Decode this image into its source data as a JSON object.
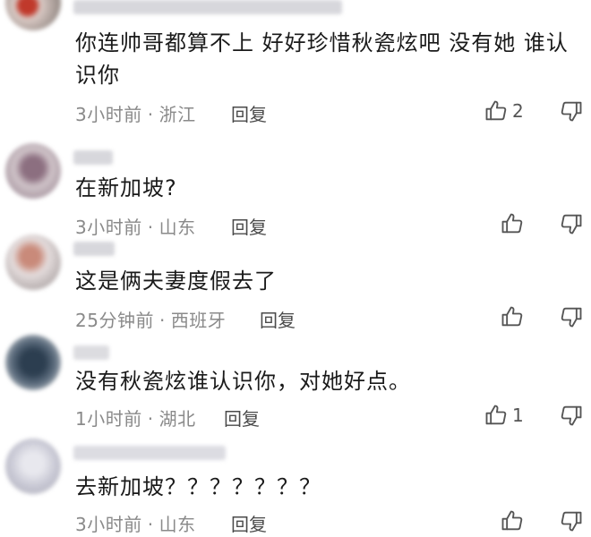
{
  "comments": [
    {
      "text": "你连帅哥都算不上  好好珍惜秋瓷炫吧 没有她 谁认识你",
      "time": "3小时前",
      "location": "浙江",
      "reply": "回复",
      "likes": "2"
    },
    {
      "text": "在新加坡?",
      "time": "3小时前",
      "location": "山东",
      "reply": "回复",
      "likes": ""
    },
    {
      "text": "这是俩夫妻度假去了",
      "time": "25分钟前",
      "location": "西班牙",
      "reply": "回复",
      "likes": ""
    },
    {
      "text": "没有秋瓷炫谁认识你，对她好点。",
      "time": "1小时前",
      "location": "湖北",
      "reply": "回复",
      "likes": "1"
    },
    {
      "text": "去新加坡？？？？？？？",
      "time": "3小时前",
      "location": "山东",
      "reply": "回复",
      "likes": ""
    }
  ],
  "separator": "·",
  "icons": {
    "like": "thumbs-up-icon",
    "dislike": "thumbs-down-icon"
  },
  "colors": {
    "text": "#1a1a1a",
    "meta": "#8a8a8a",
    "icon": "#555555"
  }
}
